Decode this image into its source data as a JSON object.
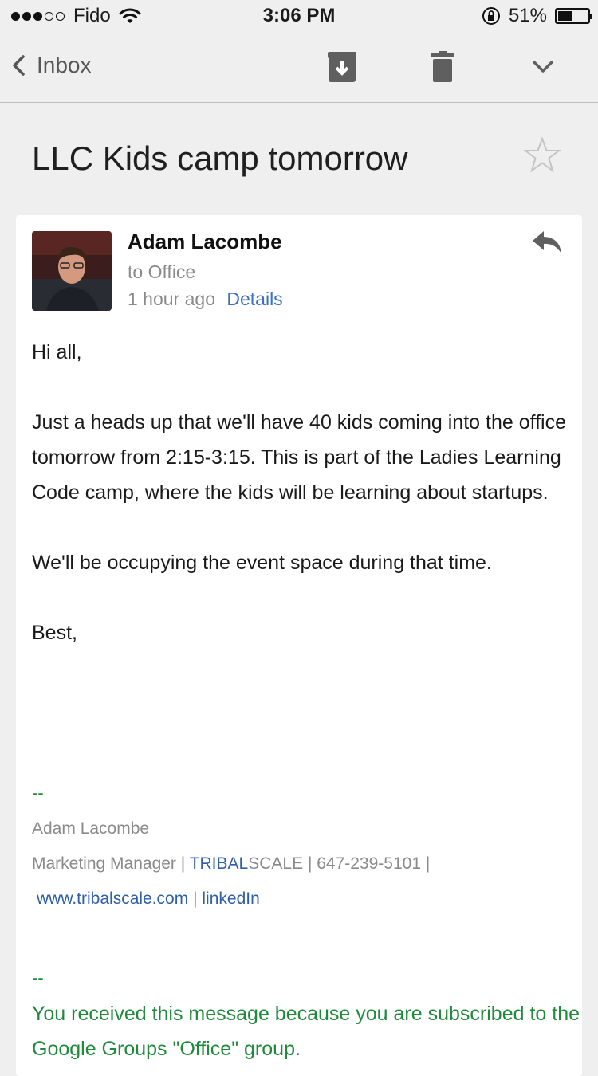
{
  "status_bar": {
    "carrier": "Fido",
    "time": "3:06 PM",
    "battery_percent": "51%",
    "battery_level": 0.51,
    "signal_bars_filled": 3,
    "signal_bars_total": 5
  },
  "nav": {
    "back_label": "Inbox",
    "icons": [
      "chevron-left-icon",
      "archive-icon",
      "trash-icon",
      "chevron-down-icon"
    ]
  },
  "subject": "LLC Kids camp tomorrow",
  "message": {
    "sender": "Adam Lacombe",
    "to": "to Office",
    "time_ago": "1 hour ago",
    "details_label": "Details",
    "body": {
      "greeting": "Hi all,",
      "paragraph1": "Just a heads up that we'll have 40 kids coming into the office tomorrow from 2:15-3:15. This is part of the Ladies Learning Code camp, where the kids will be learning about startups.",
      "paragraph2": "We'll be occupying the event space during that time.",
      "closing": "Best,"
    },
    "signature": {
      "dash": "--",
      "name": "Adam Lacombe",
      "title": "Marketing Manager |",
      "company_part1": "TRIBAL",
      "company_part2": "SCALE",
      "phone": "| 647-239-5101 |",
      "website": "www.tribalscale.com",
      "separator": "|",
      "linkedin": "linkedIn"
    },
    "footer": {
      "dash": "--",
      "text": "You received this message because you are subscribed to the Google Groups \"Office\" group."
    }
  },
  "colors": {
    "background": "#efefef",
    "link_blue": "#3b6fc1",
    "footer_green": "#1e8a3a",
    "meta_gray": "#8a8a8a"
  }
}
